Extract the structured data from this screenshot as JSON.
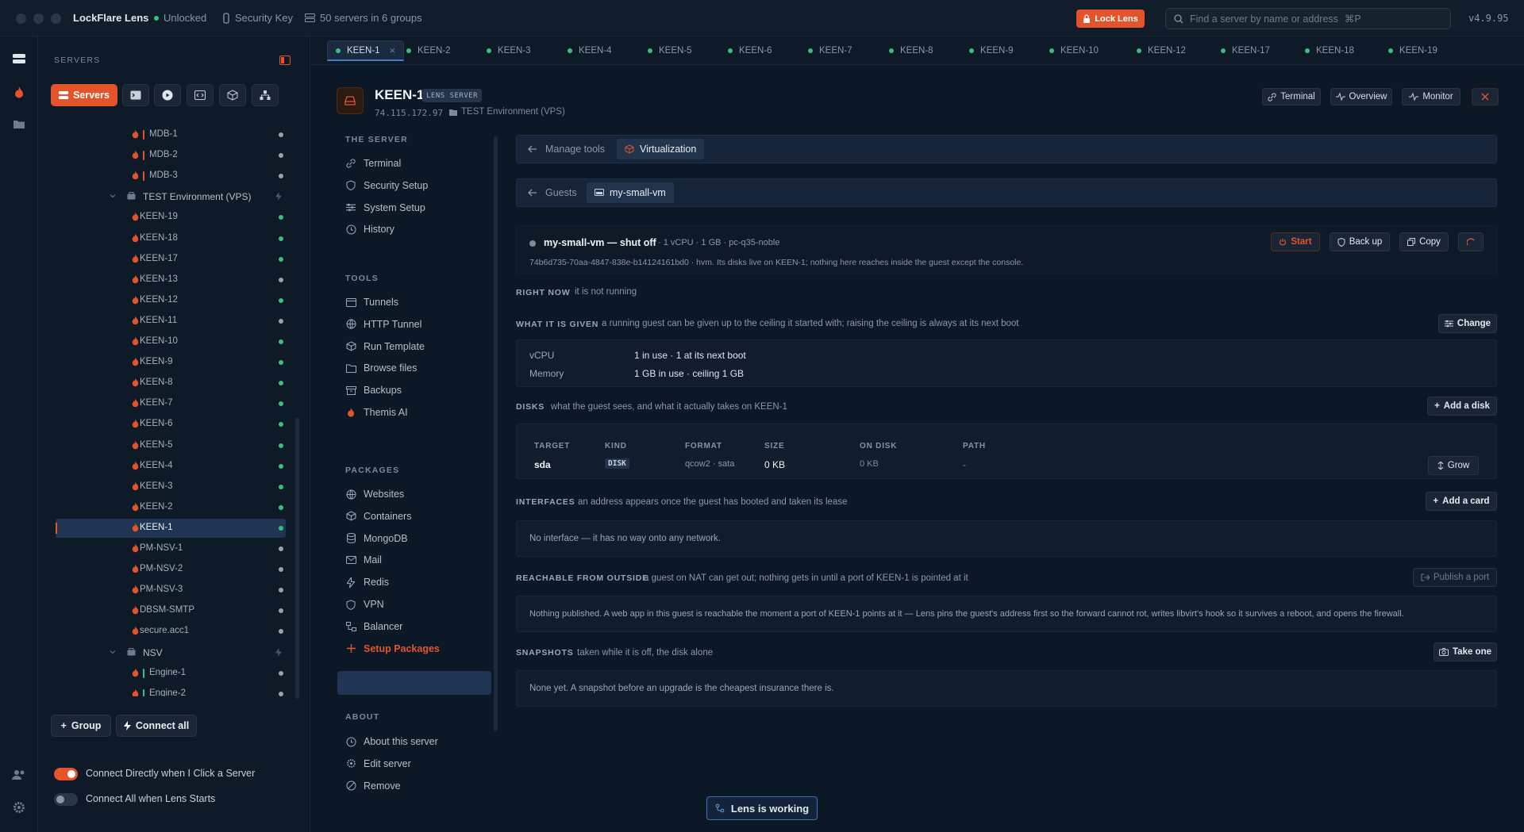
{
  "titlebar": {
    "app_name": "LockFlare Lens",
    "status": "Unlocked",
    "security_key": "Security Key",
    "server_count": "50 servers in 6 groups",
    "lock_label": "Lock Lens",
    "search_placeholder": "Find a server by name or address",
    "search_shortcut": "⌘P",
    "version": "v4.9.95"
  },
  "sidebar": {
    "title": "SERVERS",
    "servers_button": "Servers",
    "tree": [
      {
        "kind": "server",
        "label": "MDB-1",
        "bar": "#e4542a",
        "online": false
      },
      {
        "kind": "server",
        "label": "MDB-2",
        "bar": "#e4542a",
        "online": false
      },
      {
        "kind": "server",
        "label": "MDB-3",
        "bar": "#e4542a",
        "online": false
      },
      {
        "kind": "group",
        "label": "TEST Environment (VPS)"
      },
      {
        "kind": "server",
        "label": "KEEN-19",
        "online": true
      },
      {
        "kind": "server",
        "label": "KEEN-18",
        "online": true
      },
      {
        "kind": "server",
        "label": "KEEN-17",
        "online": true
      },
      {
        "kind": "server",
        "label": "KEEN-13",
        "online": false
      },
      {
        "kind": "server",
        "label": "KEEN-12",
        "online": true
      },
      {
        "kind": "server",
        "label": "KEEN-11",
        "online": false
      },
      {
        "kind": "server",
        "label": "KEEN-10",
        "online": true
      },
      {
        "kind": "server",
        "label": "KEEN-9",
        "online": true
      },
      {
        "kind": "server",
        "label": "KEEN-8",
        "online": true
      },
      {
        "kind": "server",
        "label": "KEEN-7",
        "online": true
      },
      {
        "kind": "server",
        "label": "KEEN-6",
        "online": true
      },
      {
        "kind": "server",
        "label": "KEEN-5",
        "online": true
      },
      {
        "kind": "server",
        "label": "KEEN-4",
        "online": true
      },
      {
        "kind": "server",
        "label": "KEEN-3",
        "online": true
      },
      {
        "kind": "server",
        "label": "KEEN-2",
        "online": true
      },
      {
        "kind": "server",
        "label": "KEEN-1",
        "online": true,
        "selected": true
      },
      {
        "kind": "server",
        "label": "PM-NSV-1",
        "online": false
      },
      {
        "kind": "server",
        "label": "PM-NSV-2",
        "online": false
      },
      {
        "kind": "server",
        "label": "PM-NSV-3",
        "online": false
      },
      {
        "kind": "server",
        "label": "DBSM-SMTP",
        "online": false
      },
      {
        "kind": "server",
        "label": "secure.acc1",
        "online": false
      },
      {
        "kind": "group",
        "label": "NSV"
      },
      {
        "kind": "server",
        "label": "Engine-1",
        "bar": "#35c27a",
        "online": false
      },
      {
        "kind": "server",
        "label": "Engine-2",
        "bar": "#35c27a",
        "online": false
      }
    ],
    "group_button": "Group",
    "connect_all_button": "Connect all",
    "toggle_direct": "Connect Directly when I Click a Server",
    "toggle_direct_on": true,
    "toggle_startup": "Connect All when Lens Starts",
    "toggle_startup_on": false
  },
  "tabs": [
    {
      "label": "KEEN-1",
      "active": true
    },
    {
      "label": "KEEN-2"
    },
    {
      "label": "KEEN-3"
    },
    {
      "label": "KEEN-4"
    },
    {
      "label": "KEEN-5"
    },
    {
      "label": "KEEN-6"
    },
    {
      "label": "KEEN-7"
    },
    {
      "label": "KEEN-8"
    },
    {
      "label": "KEEN-9"
    },
    {
      "label": "KEEN-10"
    },
    {
      "label": "KEEN-12"
    },
    {
      "label": "KEEN-17"
    },
    {
      "label": "KEEN-18"
    },
    {
      "label": "KEEN-19"
    }
  ],
  "server": {
    "name": "KEEN-1",
    "badge": "LENS SERVER",
    "address": "74.115.172.97",
    "environment": "TEST Environment (VPS)",
    "btn_terminal": "Terminal",
    "btn_overview": "Overview",
    "btn_monitor": "Monitor"
  },
  "nav": {
    "section_server": "THE SERVER",
    "server_items": [
      "Terminal",
      "Security Setup",
      "System Setup",
      "History"
    ],
    "section_tools": "TOOLS",
    "tool_items": [
      "Tunnels",
      "HTTP Tunnel",
      "Run Template",
      "Browse files",
      "Backups",
      "Themis AI"
    ],
    "section_packages": "PACKAGES",
    "package_items": [
      "Websites",
      "Containers",
      "MongoDB",
      "Mail",
      "Redis",
      "VPN",
      "Balancer",
      "Setup Packages"
    ],
    "section_about": "ABOUT",
    "about_items": [
      "About this server",
      "Edit server",
      "Remove"
    ]
  },
  "content": {
    "crumb1_back": "Manage tools",
    "crumb1_current": "Virtualization",
    "crumb2_back": "Guests",
    "crumb2_current": "my-small-vm",
    "vm": {
      "title": "my-small-vm — shut off",
      "spec": "· 1 vCPU · 1 GB · pc-q35-noble",
      "detail": "74b6d735-70aa-4847-838e-b14124161bd0 · hvm. Its disks live on KEEN-1; nothing here reaches inside the guest except the console.",
      "btn_start": "Start",
      "btn_backup": "Back up",
      "btn_copy": "Copy"
    },
    "right_now": {
      "title": "RIGHT NOW",
      "desc": "it is not running"
    },
    "given": {
      "title": "WHAT IT IS GIVEN",
      "desc": "a running guest can be given up to the ceiling it started with; raising the ceiling is always at its next boot",
      "btn": "Change",
      "rows": [
        {
          "k": "vCPU",
          "v": "1 in use · 1 at its next boot"
        },
        {
          "k": "Memory",
          "v": "1 GB in use · ceiling 1 GB"
        }
      ]
    },
    "disks": {
      "title": "DISKS",
      "desc": "what the guest sees, and what it actually takes on KEEN-1",
      "btn": "Add a disk",
      "headers": [
        "TARGET",
        "KIND",
        "FORMAT",
        "SIZE",
        "ON DISK",
        "PATH"
      ],
      "row": {
        "target": "sda",
        "kind": "DISK",
        "format": "qcow2 · sata",
        "size": "0 KB",
        "on_disk": "0 KB",
        "path": "-"
      },
      "grow": "Grow"
    },
    "interfaces": {
      "title": "INTERFACES",
      "desc": "an address appears once the guest has booted and taken its lease",
      "btn": "Add a card",
      "empty": "No interface — it has no way onto any network."
    },
    "reachable": {
      "title": "REACHABLE FROM OUTSIDE",
      "desc": "a guest on NAT can get out; nothing gets in until a port of KEEN-1 is pointed at it",
      "btn": "Publish a port",
      "body": "Nothing published. A web app in this guest is reachable the moment a port of KEEN-1 points at it — Lens pins the guest's address first so the forward cannot rot, writes libvirt's hook so it survives a reboot, and opens the firewall."
    },
    "snapshots": {
      "title": "SNAPSHOTS",
      "desc": "taken while it is off, the disk alone",
      "btn": "Take one",
      "empty": "None yet. A snapshot before an upgrade is the cheapest insurance there is."
    }
  },
  "working": "Lens is working",
  "colors": {
    "accent": "#e4542a",
    "online": "#35c27a",
    "offline": "#9aa3ad",
    "selected": "#1f3553"
  }
}
